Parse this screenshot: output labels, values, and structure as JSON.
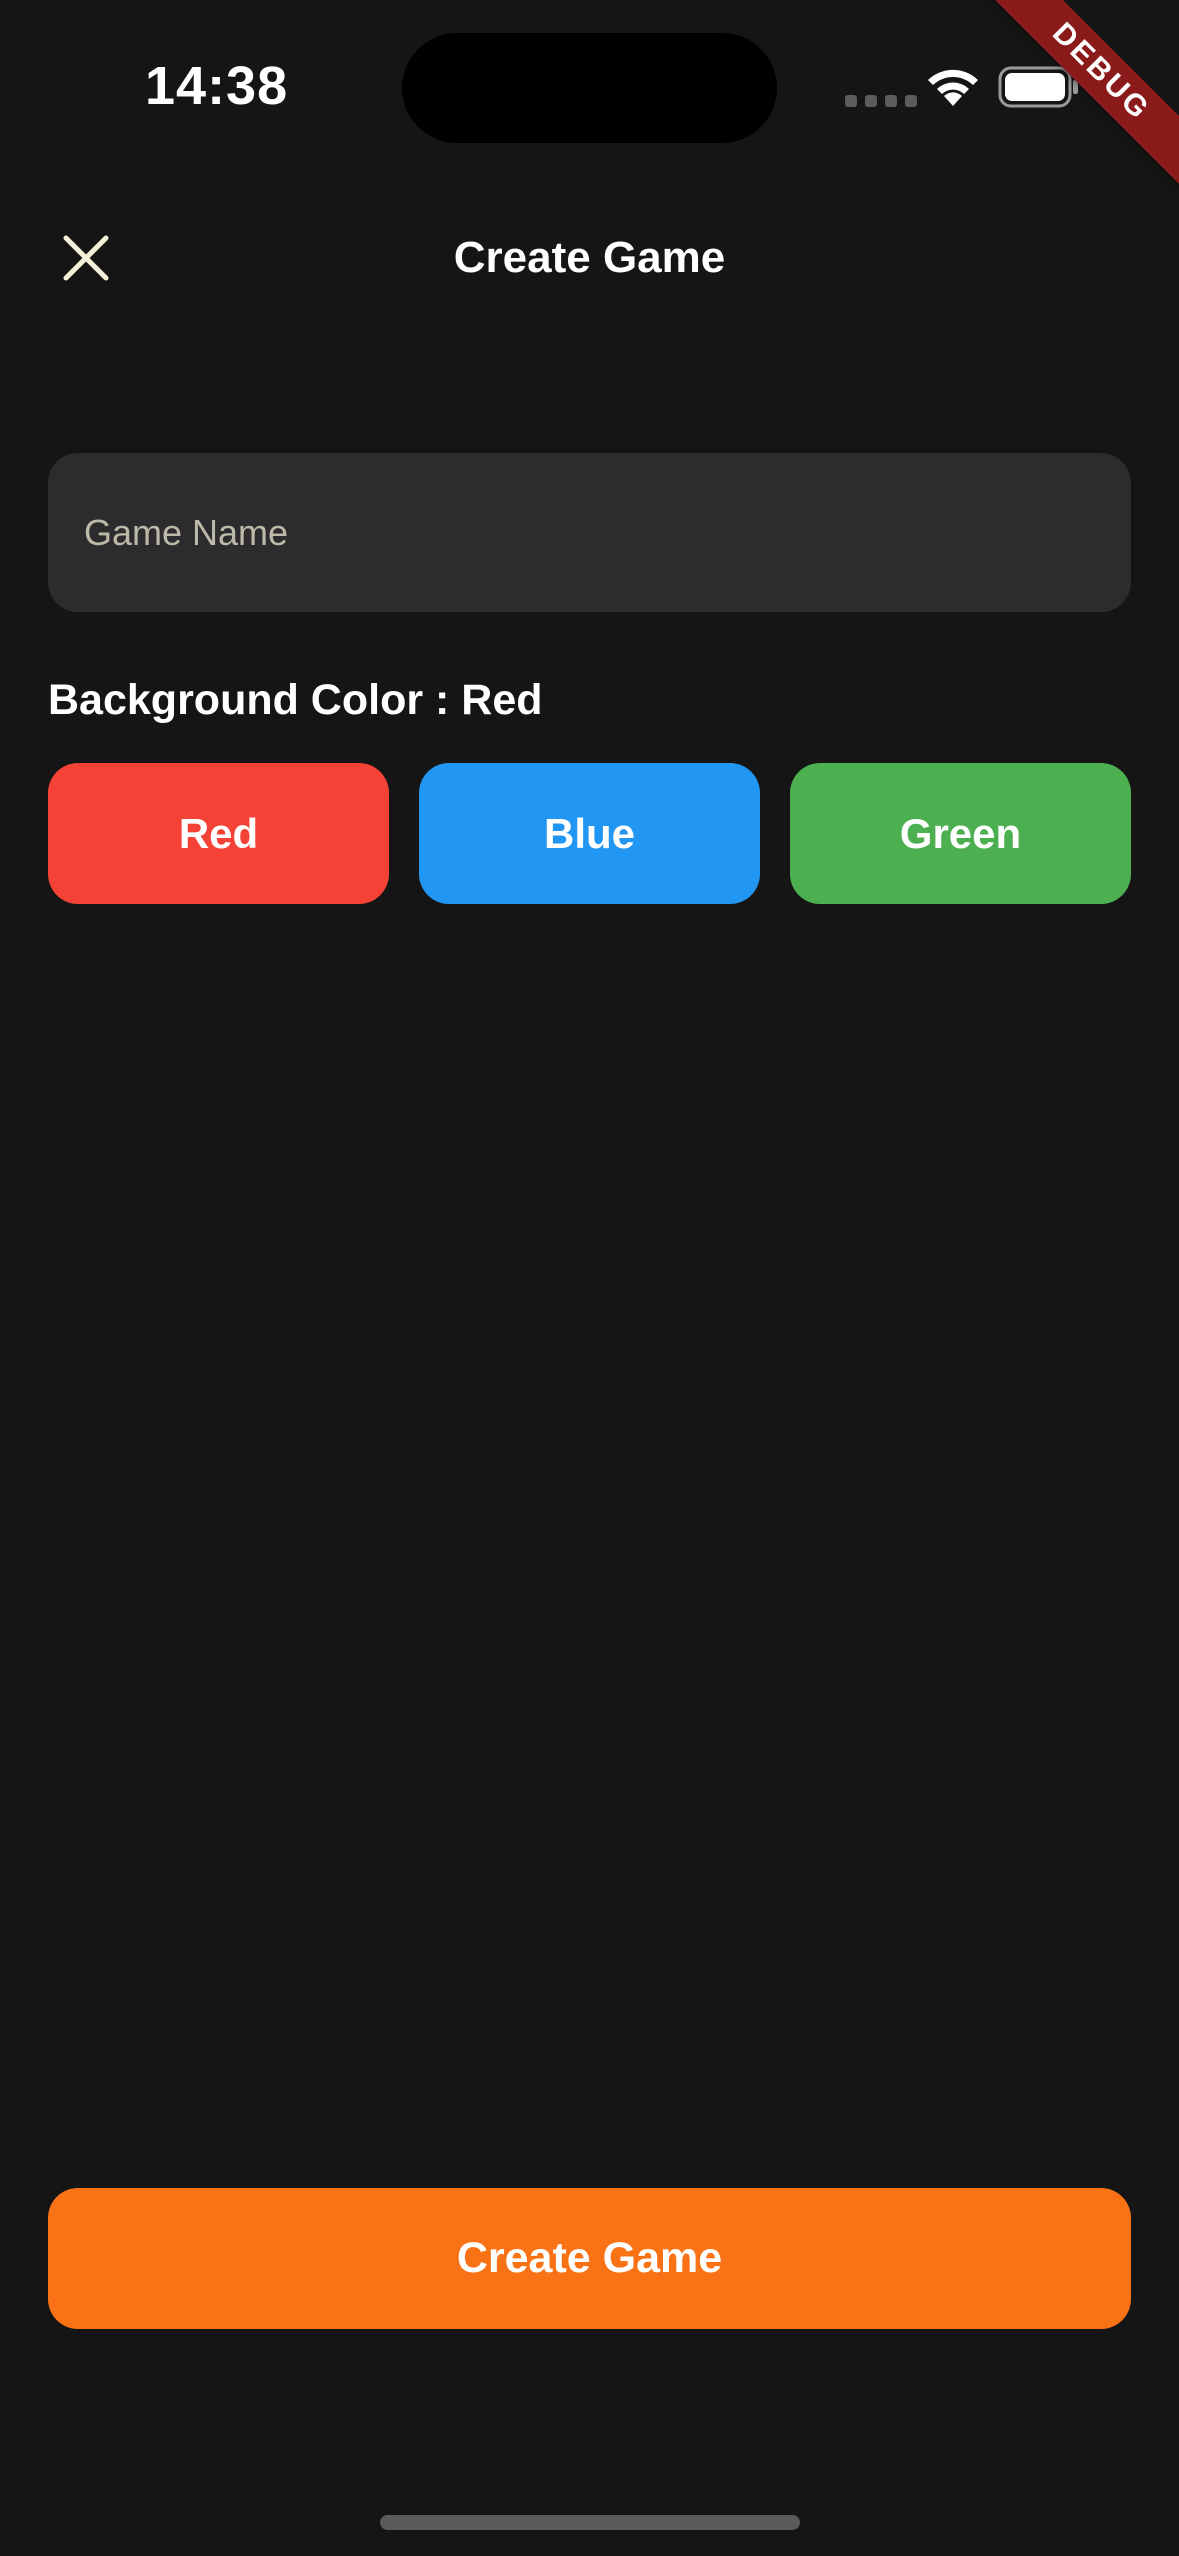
{
  "status_bar": {
    "time": "14:38"
  },
  "debug_banner": {
    "label": "DEBUG",
    "color": "#8b1a1a"
  },
  "header": {
    "close_icon": "close-icon",
    "title": "Create Game"
  },
  "form": {
    "game_name": {
      "placeholder": "Game Name",
      "value": ""
    },
    "background_color_label": "Background Color : Red",
    "color_options": [
      {
        "label": "Red",
        "color": "#f44336"
      },
      {
        "label": "Blue",
        "color": "#2196f3"
      },
      {
        "label": "Green",
        "color": "#4caf50"
      }
    ]
  },
  "actions": {
    "create_label": "Create Game",
    "create_color": "#f97316"
  },
  "theme": {
    "background": "#151515",
    "input_background": "#2c2c2e"
  }
}
